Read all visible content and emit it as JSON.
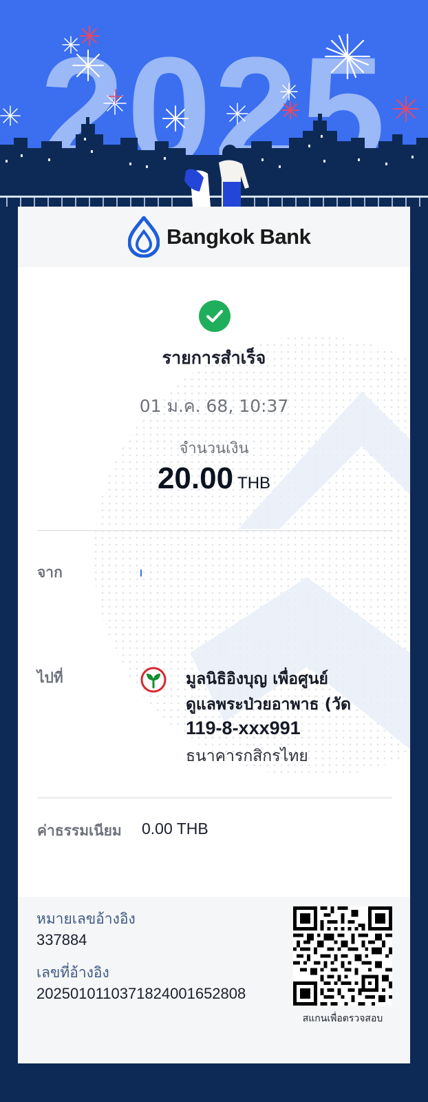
{
  "banner": {
    "year": "2025"
  },
  "header": {
    "bank_name": "Bangkok Bank"
  },
  "transaction": {
    "status": "รายการสำเร็จ",
    "datetime": "01 ม.ค. 68, 10:37",
    "amount_label": "จำนวนเงิน",
    "amount_value": "20.00",
    "amount_currency": "THB"
  },
  "from": {
    "label": "จาก"
  },
  "to": {
    "label": "ไปที่",
    "name_line1": "มูลนิธิอิงบุญ เพื่อศูนย์",
    "name_line2": "ดูแลพระป่วยอาพาธ (วัด",
    "account": "119-8-xxx991",
    "bank": "ธนาคารกสิกรไทย",
    "bank_icon": "kasikorn-bank-icon"
  },
  "fee": {
    "label": "ค่าธรรมเนียม",
    "value": "0.00 THB"
  },
  "reference": {
    "ref_label": "หมายเลขอ้างอิง",
    "ref_value": "337884",
    "ref_no_label": "เลขที่อ้างอิง",
    "ref_no_value": "2025010110371824001652808",
    "qr_caption": "สแกนเพื่อตรวจสอบ"
  },
  "colors": {
    "banner_blue": "#3b6ff0",
    "page_navy": "#0d2a57",
    "success_green": "#1fae5b",
    "brand_blue": "#1e5fd8",
    "kbank_green": "#138f2d"
  }
}
